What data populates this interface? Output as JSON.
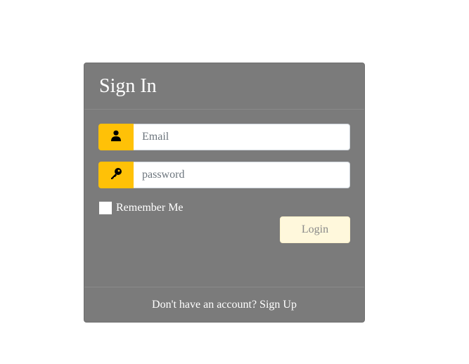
{
  "card": {
    "title": "Sign In"
  },
  "form": {
    "email": {
      "placeholder": "Email",
      "value": "",
      "icon": "user-icon"
    },
    "password": {
      "placeholder": "password",
      "value": "",
      "icon": "key-icon"
    },
    "remember_label": "Remember Me",
    "remember_checked": false,
    "login_label": "Login"
  },
  "footer": {
    "prompt": "Don't have an account?",
    "signup_label": "Sign Up"
  },
  "colors": {
    "card_bg": "#7b7b7b",
    "addon_bg": "#ffc107",
    "login_bg": "#fff8dc"
  }
}
